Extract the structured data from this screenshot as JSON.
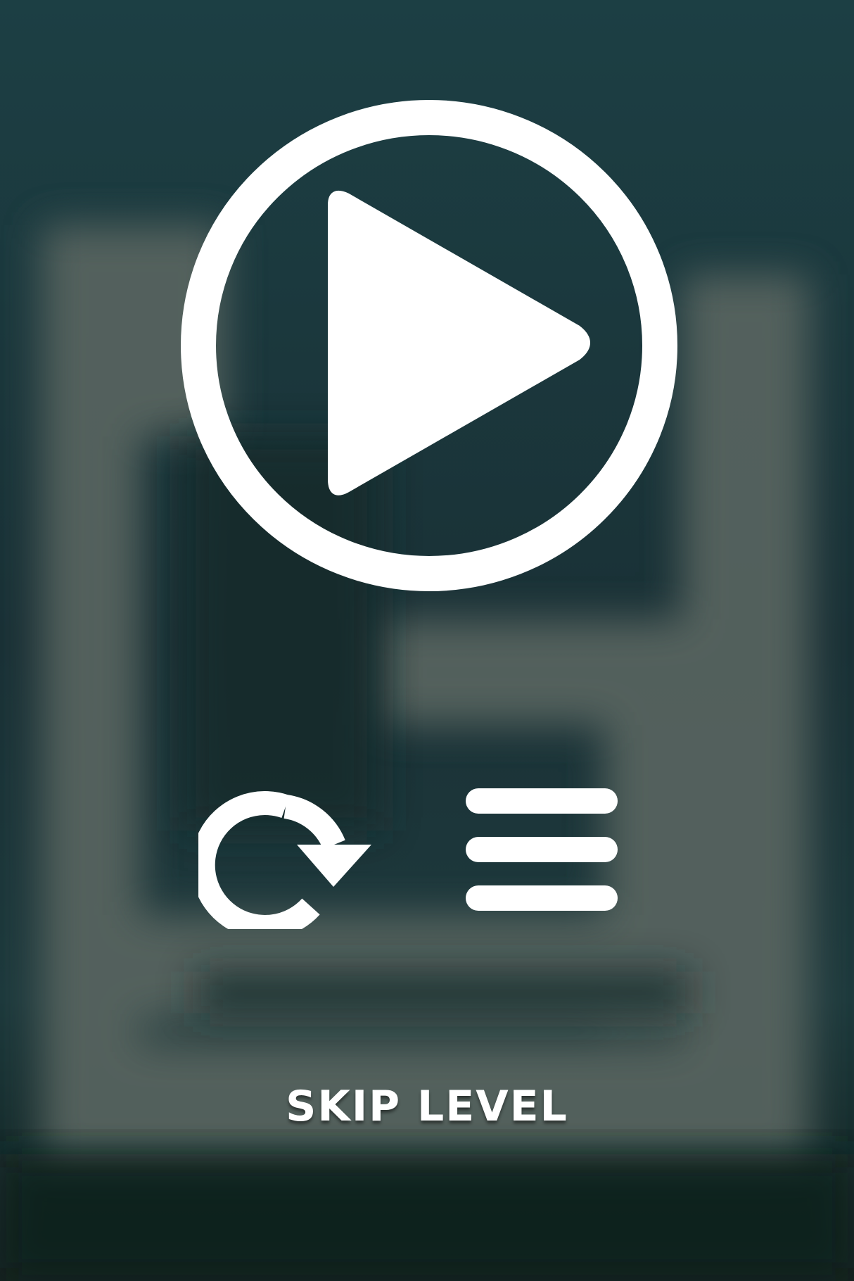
{
  "pause_menu": {
    "play_icon": "play-circle-icon",
    "restart_icon": "restart-icon",
    "menu_icon": "hamburger-menu-icon",
    "skip_level_label": "SKIP LEVEL"
  },
  "colors": {
    "background_dark": "#1b353a",
    "background_bottom": "#12262a",
    "maze_blur": "#56645e",
    "icon": "#ffffff"
  }
}
